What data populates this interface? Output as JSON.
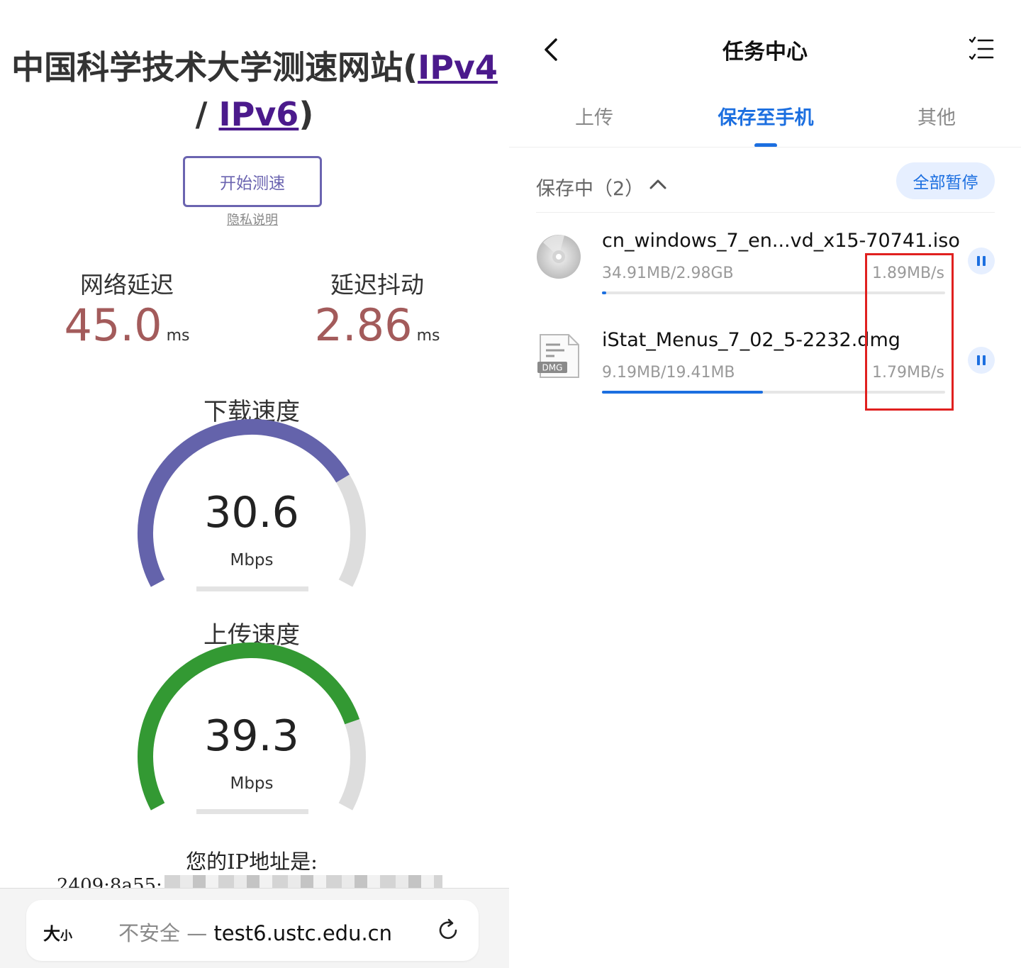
{
  "speedtest": {
    "title_main": "中国科学技术大学测速网站(",
    "title_ipv4": "IPv4",
    "title_sep": "/ ",
    "title_ipv6": "IPv6",
    "title_close": ")",
    "start_button": "开始测速",
    "privacy_link": "隐私说明",
    "latency": {
      "label": "网络延迟",
      "value": "45.0",
      "unit": "ms"
    },
    "jitter": {
      "label": "延迟抖动",
      "value": "2.86",
      "unit": "ms"
    },
    "download": {
      "label": "下载速度",
      "value": "30.6",
      "unit": "Mbps",
      "gauge_fraction": 0.75,
      "color": "#6463ab"
    },
    "upload": {
      "label": "上传速度",
      "value": "39.3",
      "unit": "Mbps",
      "gauge_fraction": 0.8,
      "color": "#339933"
    },
    "ip_label": "您的IP地址是:",
    "ip_value_visible": "2409:8a55:"
  },
  "browser": {
    "size_button": "大",
    "size_button_small": "小",
    "insecure_label": "不安全 — ",
    "url": "test6.ustc.edu.cn",
    "reload_icon": "reload-icon"
  },
  "task_center": {
    "title": "任务中心",
    "tabs": [
      {
        "label": "上传",
        "active": false
      },
      {
        "label": "保存至手机",
        "active": true
      },
      {
        "label": "其他",
        "active": false
      }
    ],
    "section": {
      "label": "保存中（2）",
      "pause_all": "全部暂停"
    },
    "tasks": [
      {
        "name": "cn_windows_7_en...vd_x15-70741.iso",
        "size": "34.91MB/2.98GB",
        "speed": "1.89MB/s",
        "progress": 0.012,
        "icon": "disc-icon"
      },
      {
        "name": "iStat_Menus_7_02_5-2232.dmg",
        "size": "9.19MB/19.41MB",
        "speed": "1.79MB/s",
        "progress": 0.47,
        "icon": "dmg-file-icon",
        "icon_label": "DMG"
      }
    ],
    "highlight_color": "#e0201f"
  }
}
